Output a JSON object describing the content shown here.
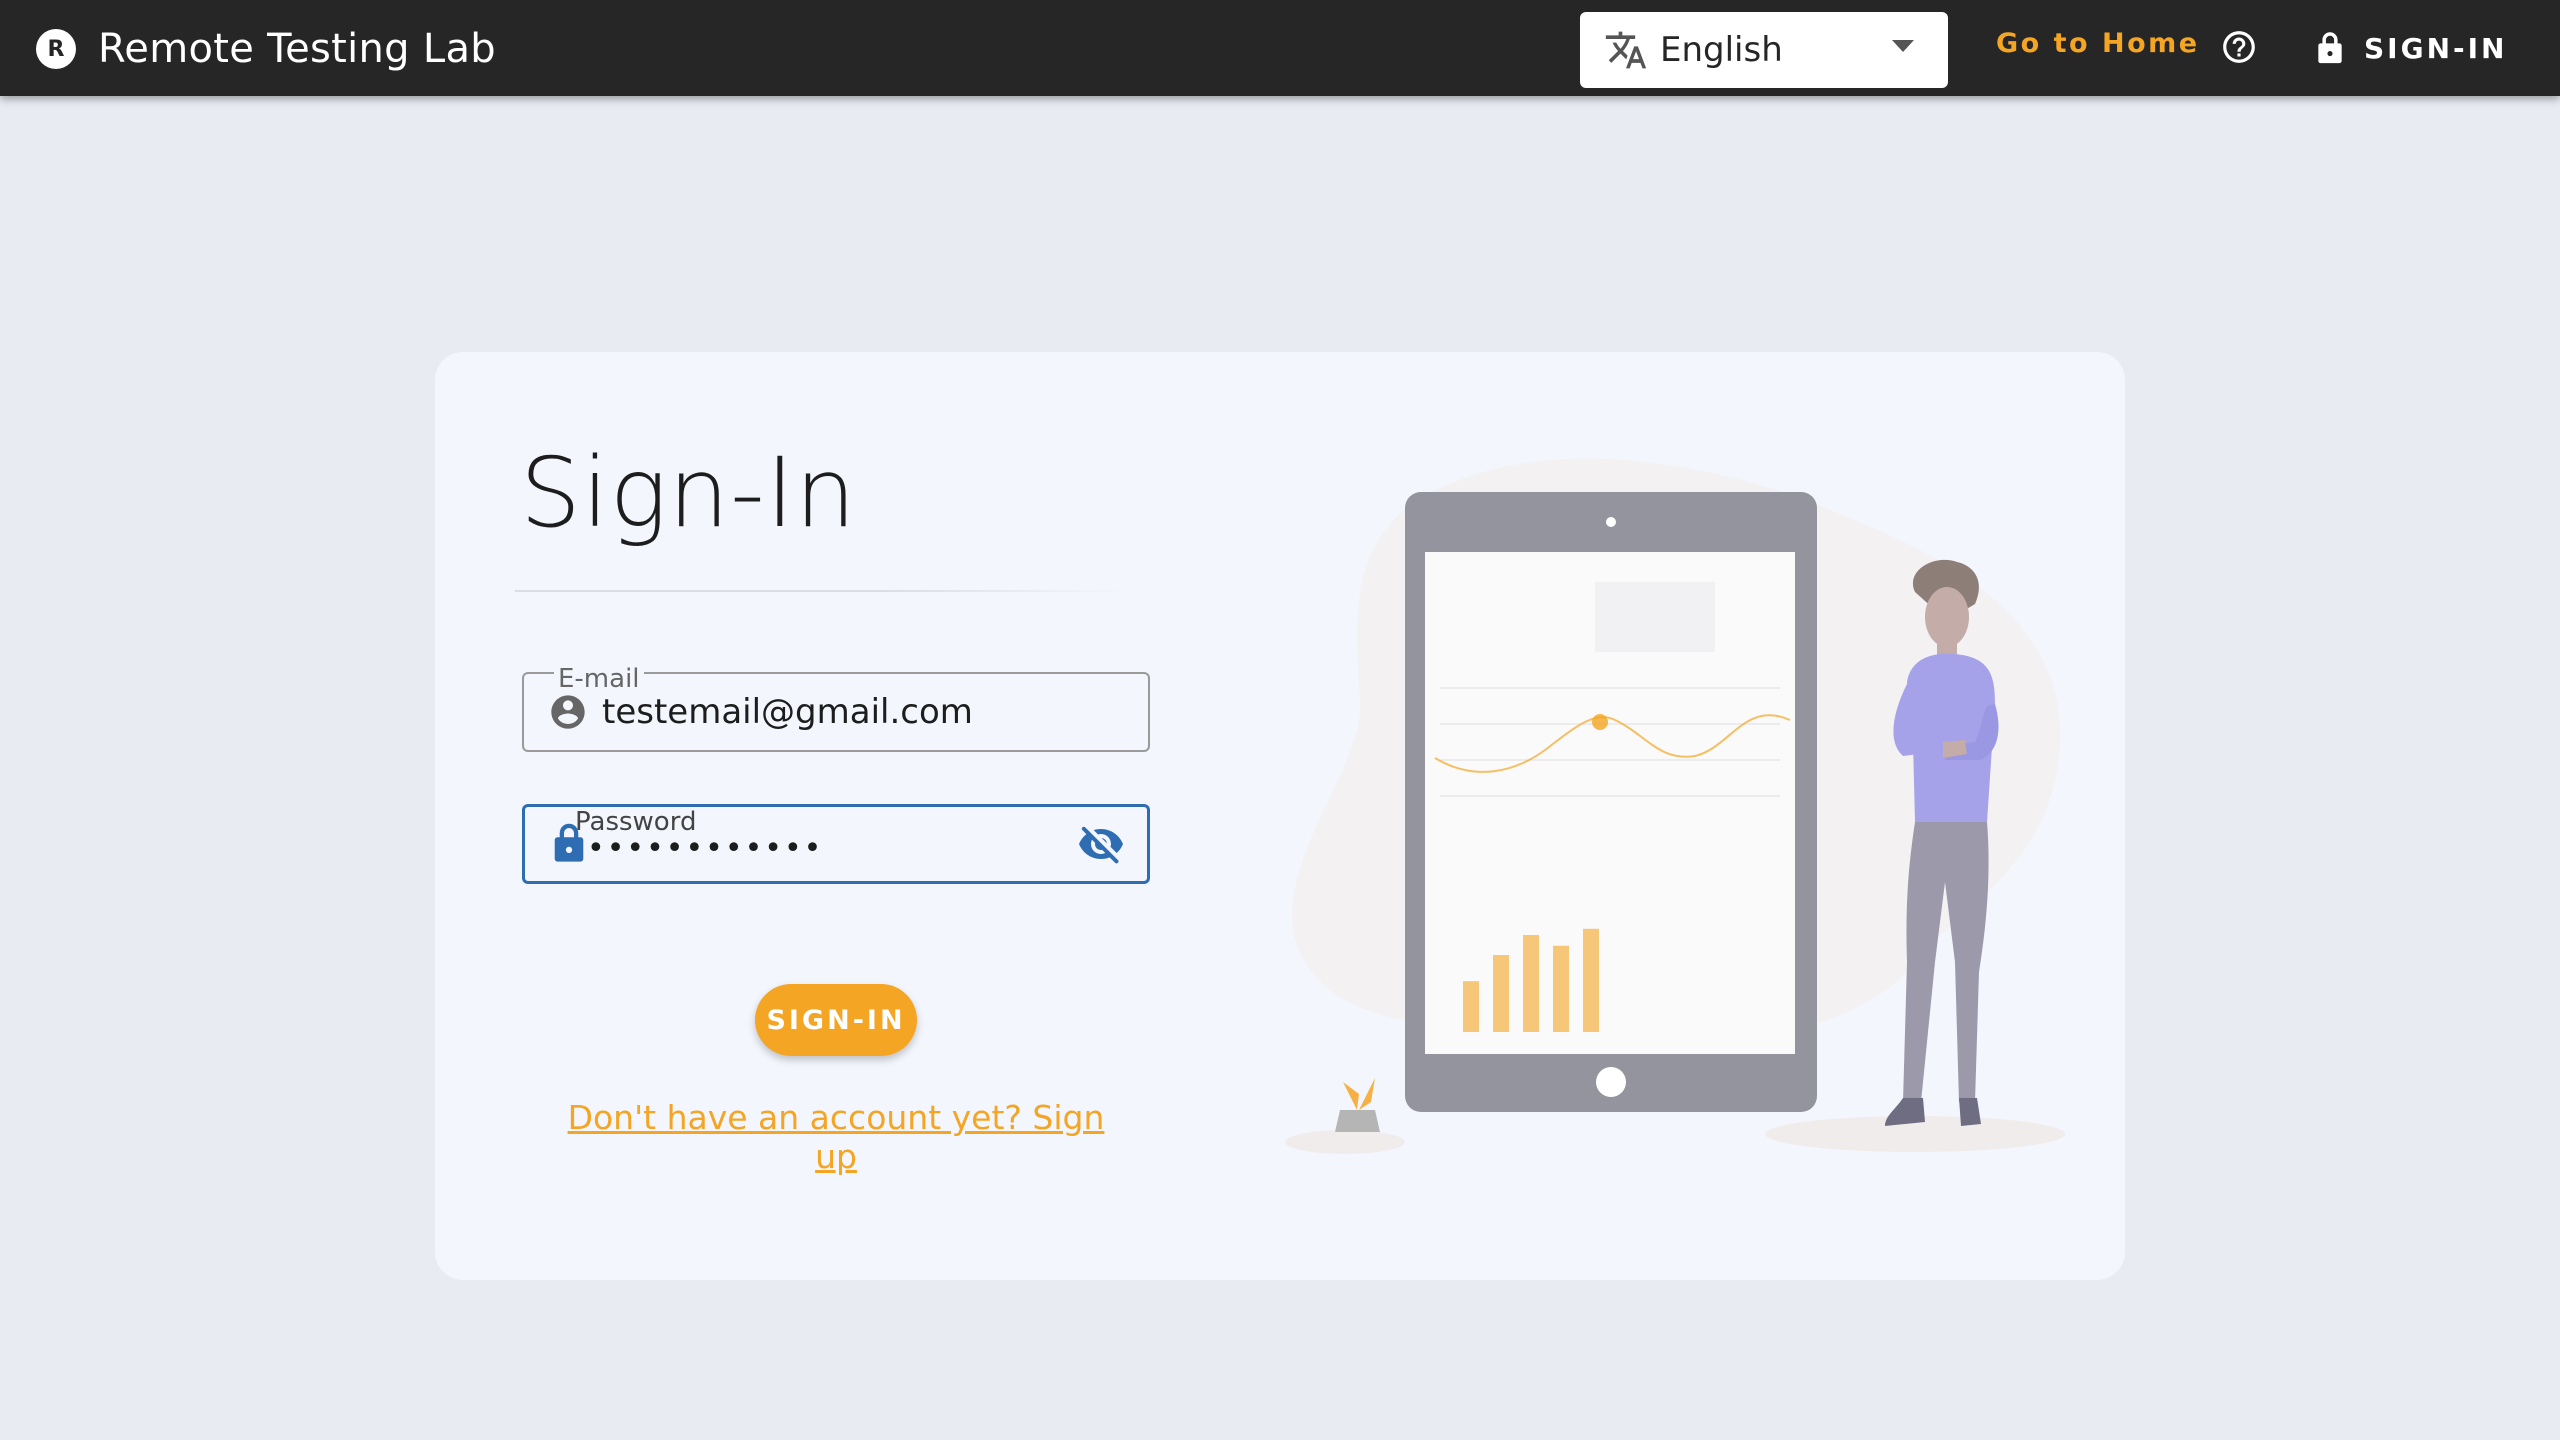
{
  "header": {
    "brand_logo_letter": "R",
    "brand_title": "Remote Testing Lab",
    "language": {
      "selected": "English",
      "icon": "translate-icon"
    },
    "go_home_label": "Go to Home",
    "help_icon": "help-circle-icon",
    "signin_label": "SIGN-IN",
    "signin_icon": "lock-icon"
  },
  "form": {
    "title": "Sign-In",
    "email": {
      "label": "E-mail",
      "value": "testemail@gmail.com",
      "icon": "account-circle-icon"
    },
    "password": {
      "label": "Password",
      "value": "••••••••••••",
      "icon": "lock-icon",
      "toggle_icon": "eye-off-icon"
    },
    "submit_label": "SIGN-IN",
    "signup_link": "Don't have an account yet? Sign up"
  },
  "illustration": {
    "name": "person-with-tablet-illustration",
    "chart_bars": [
      0.33,
      0.5,
      0.63,
      0.56,
      0.67
    ],
    "colors": {
      "accent": "#f4a523",
      "tablet": "#94949f",
      "person_shirt": "#a5a2ea"
    }
  },
  "colors": {
    "topbar": "#262626",
    "accent": "#f4a523",
    "focus": "#2f6db3",
    "background": "#e8ebf2",
    "card": "#f3f6fd"
  }
}
